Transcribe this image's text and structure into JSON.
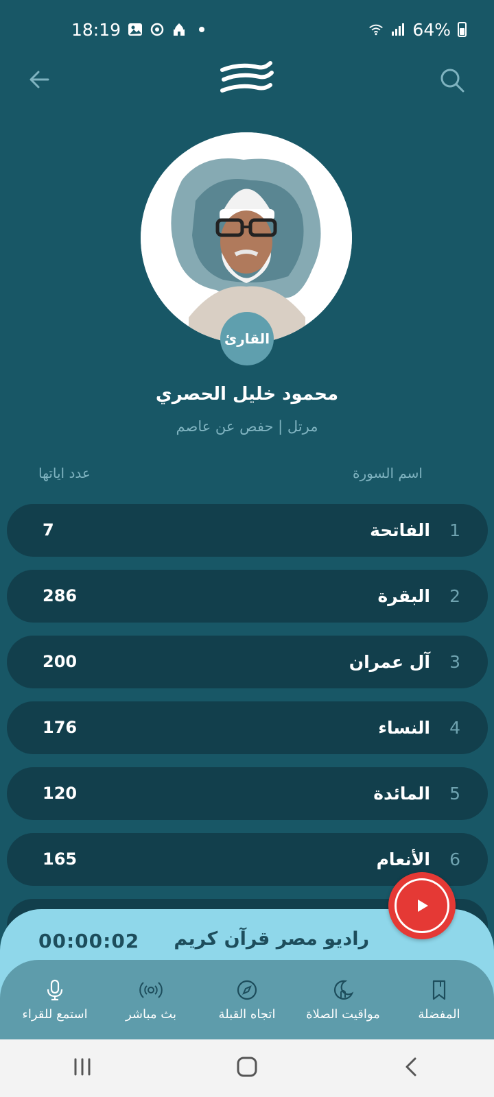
{
  "status_bar": {
    "time": "18:19",
    "battery": "64%"
  },
  "reciter": {
    "badge": "القارئ",
    "name": "محمود خليل الحصري",
    "rewaya": "مرتل | حفص عن عاصم"
  },
  "columns": {
    "surah": "اسم السورة",
    "ayat": "عدد اياتها"
  },
  "surahs": [
    {
      "num": "1",
      "name": "الفاتحة",
      "ayat": "7"
    },
    {
      "num": "2",
      "name": "البقرة",
      "ayat": "286"
    },
    {
      "num": "3",
      "name": "آل عمران",
      "ayat": "200"
    },
    {
      "num": "4",
      "name": "النساء",
      "ayat": "176"
    },
    {
      "num": "5",
      "name": "المائدة",
      "ayat": "120"
    },
    {
      "num": "6",
      "name": "الأنعام",
      "ayat": "165"
    }
  ],
  "player": {
    "time": "00:00:02",
    "title": "راديو مصر قرآن كريم"
  },
  "nav": {
    "favorites": "المفضلة",
    "prayer_times": "مواقيت الصلاة",
    "qibla": "اتجاه القبلة",
    "live": "بث مباشر",
    "listen": "استمع للقراء"
  },
  "colors": {
    "background": "#185766",
    "row": "#123f4c",
    "player": "#8fd7ea",
    "nav": "#5e9cab",
    "play_button": "#e53935"
  }
}
